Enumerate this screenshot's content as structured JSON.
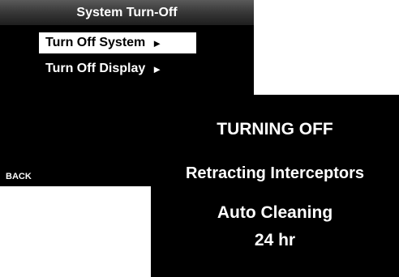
{
  "menu_screen": {
    "title": "System Turn-Off",
    "items": [
      {
        "label": "Turn Off System",
        "arrow": "►",
        "selected": true
      },
      {
        "label": "Turn Off Display",
        "arrow": "►",
        "selected": false
      }
    ],
    "back_label": "BACK"
  },
  "status_screen": {
    "title": "TURNING OFF",
    "message": "Retracting Interceptors",
    "cleaning_label": "Auto Cleaning",
    "cleaning_time": "24 hr"
  },
  "colors": {
    "screen_background": "#000000",
    "text": "#ffffff",
    "selected_background": "#ffffff",
    "selected_text": "#000000",
    "page_background": "#ffffff"
  }
}
